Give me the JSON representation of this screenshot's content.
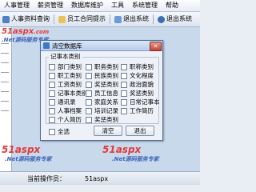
{
  "menubar": {
    "items": [
      "人事管理",
      "薪资管理",
      "数据库维护",
      "工具",
      "系统管理",
      "帮助"
    ]
  },
  "toolbar": {
    "items": [
      "人事资料查询",
      "员工合同提示",
      "退出系统",
      "退出系统"
    ]
  },
  "dialog": {
    "title": "清空数据库",
    "group_label": "记事本类别",
    "options": [
      [
        "部门类别",
        "职务类别",
        "职称类别"
      ],
      [
        "职工类别",
        "民族类别",
        "文化程度"
      ],
      [
        "工资类别",
        "奖惩类别",
        "政治面貌"
      ],
      [
        "记事本类别",
        "员工信息",
        "奖惩类别"
      ],
      [
        "通讯录",
        "家庭关系",
        "日常记事本"
      ],
      [
        "人事档案",
        "培训记录",
        "工作简历"
      ],
      [
        "个人简历",
        "奖惩类别",
        ""
      ]
    ],
    "select_all": "全选",
    "ok": "清空",
    "cancel": "退出"
  },
  "statusbar": {
    "left": "当前操作员：",
    "user": "51aspx"
  },
  "watermarks": {
    "brand": "51aspx",
    "brand_tail": ".com",
    "slogan": ".Net源码服务专家"
  },
  "colors": {
    "watermark_red": "#e03a3a",
    "watermark_blue": "#3c63b8",
    "accent": "#3d78c8"
  }
}
